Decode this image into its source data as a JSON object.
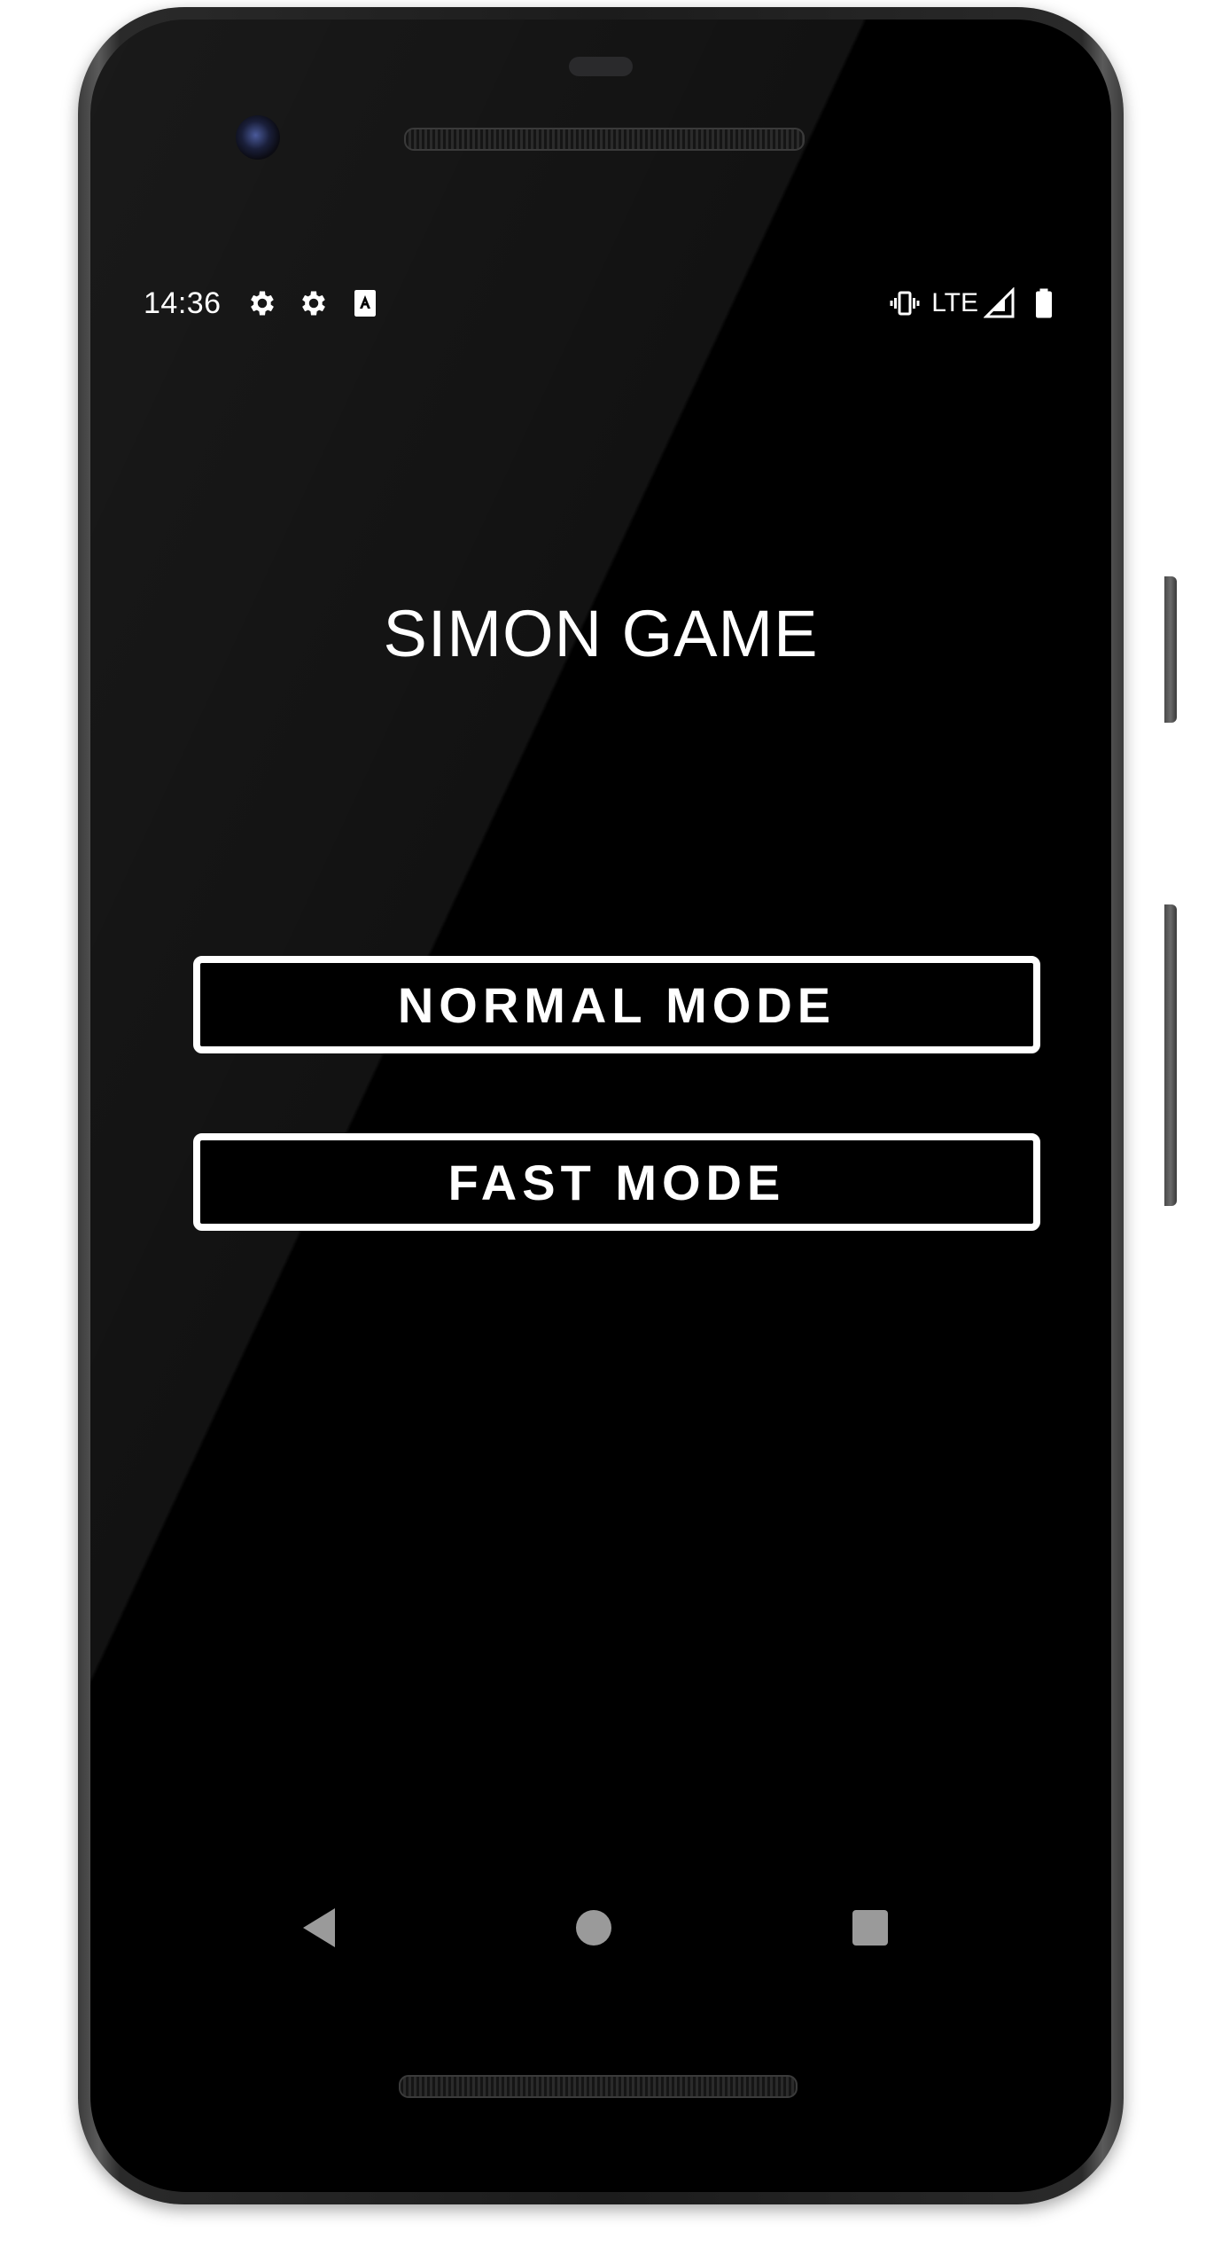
{
  "status_bar": {
    "time": "14:36",
    "left_icons": [
      "settings-gear-icon",
      "settings-gear-icon",
      "accessibility-a-icon"
    ],
    "network": "LTE",
    "right_icons": [
      "vibrate-icon",
      "signal-icon",
      "battery-icon"
    ]
  },
  "app": {
    "title": "SIMON GAME",
    "buttons": {
      "normal": "NORMAL MODE",
      "fast": "FAST MODE"
    }
  },
  "nav_bar": {
    "icons": [
      "back-icon",
      "home-icon",
      "recents-icon"
    ]
  },
  "colors": {
    "screen_background": "#000000",
    "foreground": "#ffffff",
    "nav_icons": "#9a9a9a"
  }
}
